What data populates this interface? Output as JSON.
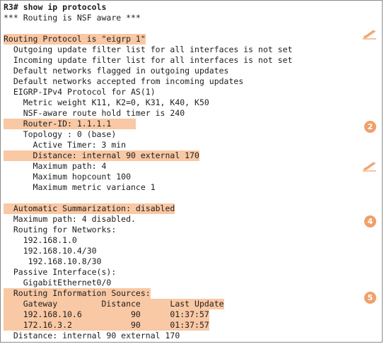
{
  "terminal": {
    "prompt": "R3# ",
    "command": "show ip protocols",
    "nsf_line": "*** Routing is NSF aware ***",
    "routing_protocol": "Routing Protocol is \"eigrp 1\"",
    "outgoing_filter": "  Outgoing update filter list for all interfaces is not set",
    "incoming_filter": "  Incoming update filter list for all interfaces is not set",
    "default_outgoing": "  Default networks flagged in outgoing updates",
    "default_incoming": "  Default networks accepted from incoming updates",
    "eigrp_as": "  EIGRP-IPv4 Protocol for AS(1)",
    "metric_weight": "    Metric weight K11, K2=0, K31, K40, K50",
    "nsf_timer": "    NSF-aware route hold timer is 240",
    "router_id": "    Router-ID: 1.1.1.1     ",
    "topology": "    Topology : 0 (base)",
    "active_timer": "      Active Timer: 3 min",
    "distance_internal": "      Distance: internal 90 external 170",
    "max_path": "      Maximum path: 4",
    "max_hopcount": "      Maximum hopcount 100",
    "max_variance": "      Maximum metric variance 1",
    "auto_summary": "  Automatic Summarization: disabled",
    "max_path_disabled": "  Maximum path: 4 disabled.",
    "routing_networks": "  Routing for Networks:",
    "net1": "    192.168.1.0",
    "net2": "    192.168.10.4/30",
    "net3": "     192.168.10.8/30",
    "passive_if": "  Passive Interface(s):",
    "passive_if1": "    GigabitEthernet0/0",
    "info_sources": "  Routing Information Sources:",
    "sources_header": "    Gateway         Distance      Last Update",
    "source1": "    192.168.10.6          90      01:37:57",
    "source2": "    172.16.3.2            90      01:37:57",
    "distance_final": "  Distance: internal 90 external 170"
  },
  "annotations": {
    "badge_2": "2",
    "badge_4": "4",
    "badge_5": "5",
    "pen_icon": "pencil-icon",
    "badge_color": "#f0a06a",
    "highlight_color": "#f9c8a4"
  }
}
